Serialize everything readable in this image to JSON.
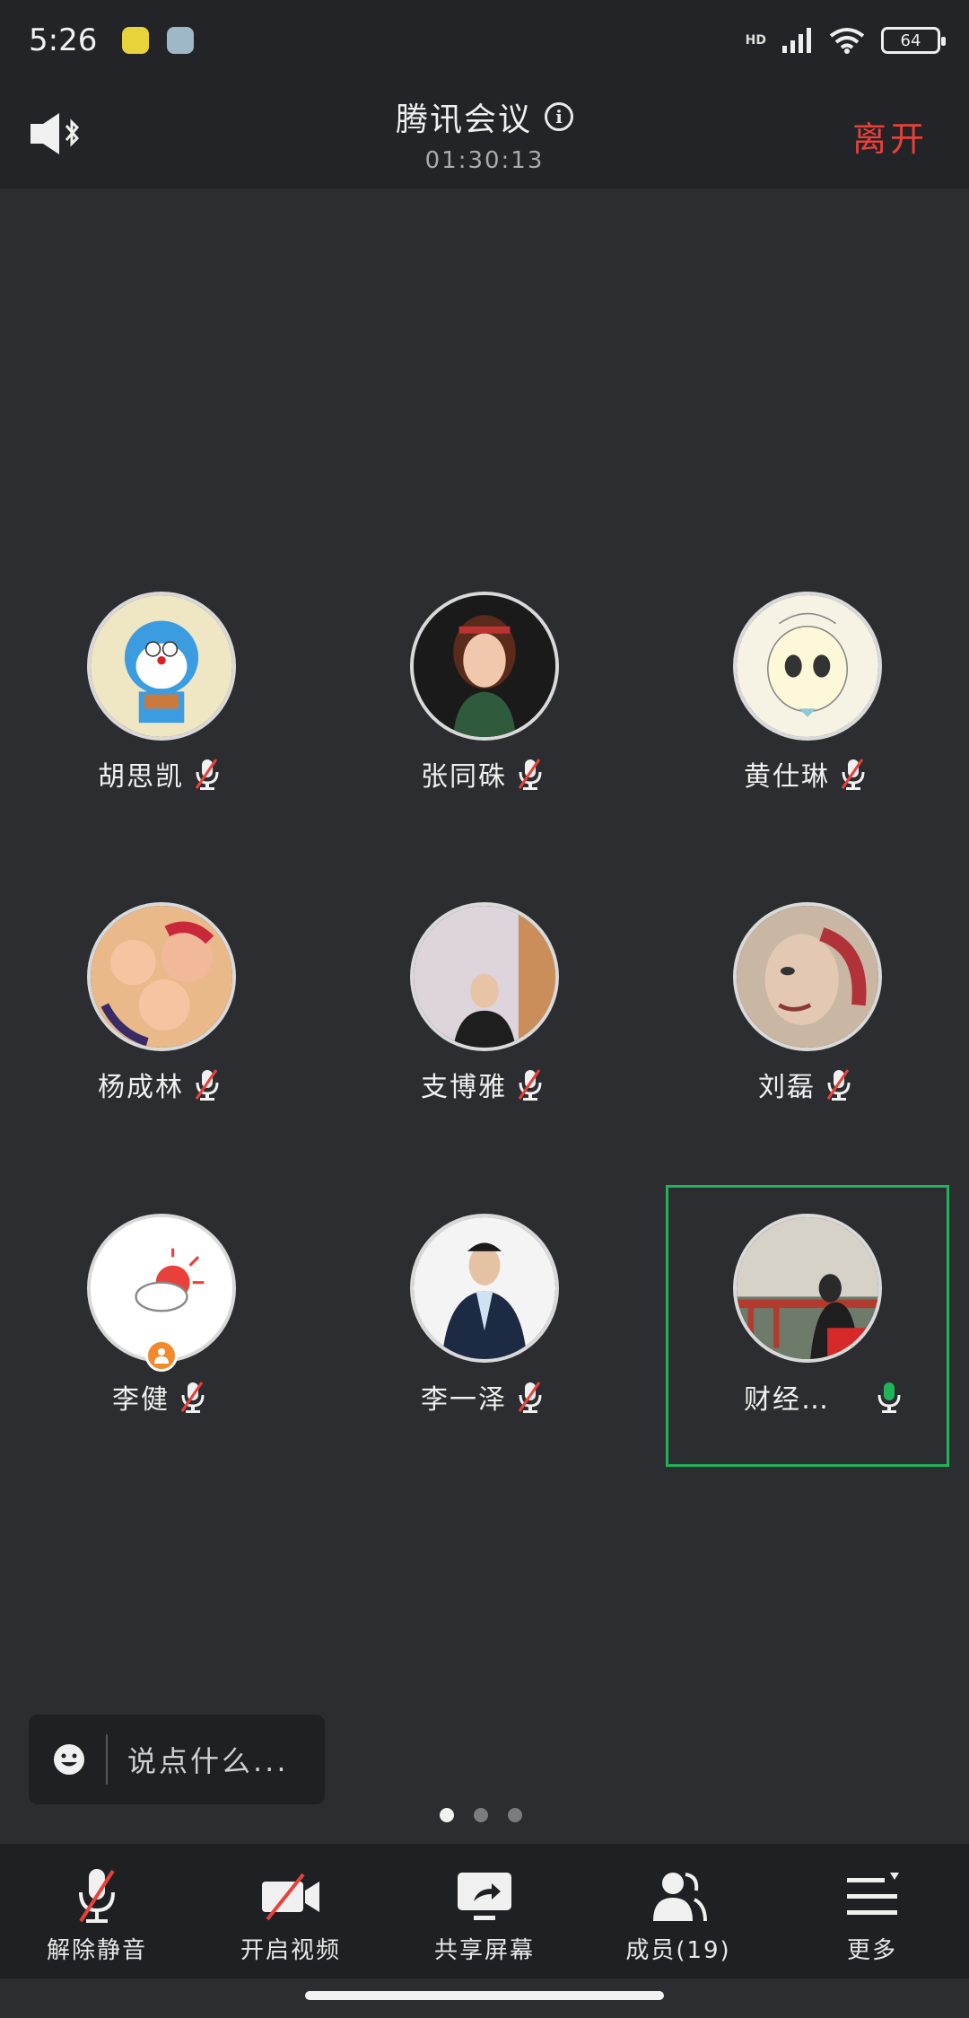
{
  "status_bar": {
    "time": "5:26",
    "network": "HD",
    "battery": "64"
  },
  "header": {
    "title": "腾讯会议",
    "timer": "01:30:13",
    "leave_label": "离开"
  },
  "participants": [
    {
      "name": "胡思凯",
      "mic": "muted"
    },
    {
      "name": "张同硃",
      "mic": "muted"
    },
    {
      "name": "黄仕琳",
      "mic": "muted"
    },
    {
      "name": "杨成林",
      "mic": "muted"
    },
    {
      "name": "支博雅",
      "mic": "muted"
    },
    {
      "name": "刘磊",
      "mic": "muted"
    },
    {
      "name": "李健",
      "mic": "muted",
      "host": true
    },
    {
      "name": "李一泽",
      "mic": "muted"
    },
    {
      "name": "财经…",
      "mic": "active",
      "speaking": true
    }
  ],
  "chat": {
    "placeholder": "说点什么..."
  },
  "pager": {
    "pages": 3,
    "current": 1
  },
  "toolbar": {
    "unmute": "解除静音",
    "video": "开启视频",
    "share": "共享屏幕",
    "members": "成员(19)",
    "more": "更多"
  },
  "colors": {
    "background": "#2c2d30",
    "header": "#232427",
    "leave": "#e8403a",
    "speaking_border": "#1fb35a",
    "mic_active": "#1fb35a",
    "mic_muted_slash": "#e8403a"
  },
  "icons": {
    "speaker": "speaker-bluetooth-icon",
    "info": "info-icon",
    "emoji": "emoji-icon",
    "mic_muted": "mic-muted-icon",
    "mic_active": "mic-icon",
    "video_off": "video-off-icon",
    "share": "share-screen-icon",
    "members": "members-icon",
    "more": "more-menu-icon"
  }
}
